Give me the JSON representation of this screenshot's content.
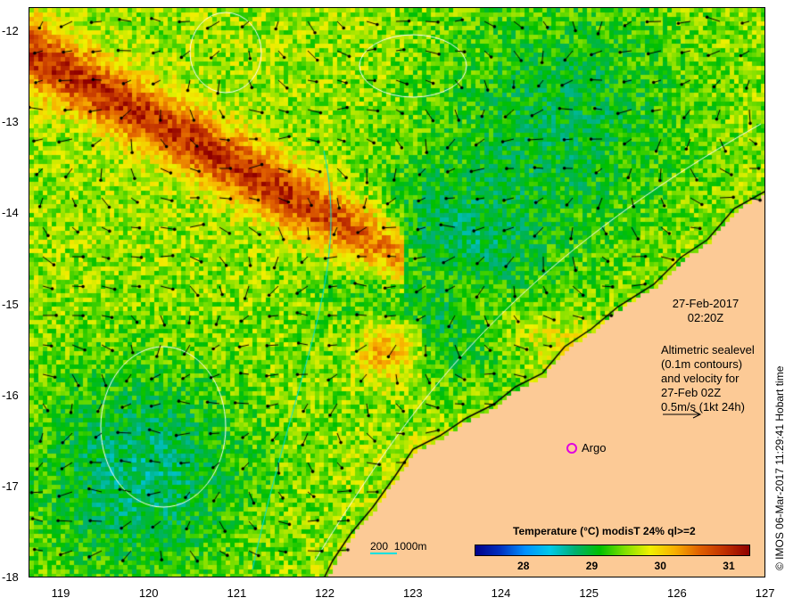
{
  "map": {
    "x_ticks": [
      "119",
      "120",
      "121",
      "122",
      "123",
      "124",
      "125",
      "126",
      "127"
    ],
    "y_ticks": [
      "-12",
      "-13",
      "-14",
      "-15",
      "-16",
      "-17",
      "-18"
    ],
    "date": "27-Feb-2017",
    "time": "02:20Z",
    "description": [
      "Altimetric sealevel",
      "(0.1m contours)",
      "and velocity for",
      "27-Feb 02Z",
      "0.5m/s (1kt 24h)"
    ],
    "argo_label": "Argo",
    "depth_scale": "200  1000m",
    "copyright": "© IMOS 06-Mar-2017 11:29:41 Hobart time",
    "colorbar": {
      "title": "Temperature (°C) modisT 24% ql>=2",
      "ticks": [
        "28",
        "29",
        "30",
        "31"
      ],
      "range": [
        27.3,
        31.3
      ]
    },
    "colors": {
      "land": "#fcca96",
      "argo": "#e000e0",
      "contour": "#ffffff",
      "isobath": "#00e0e0"
    }
  }
}
